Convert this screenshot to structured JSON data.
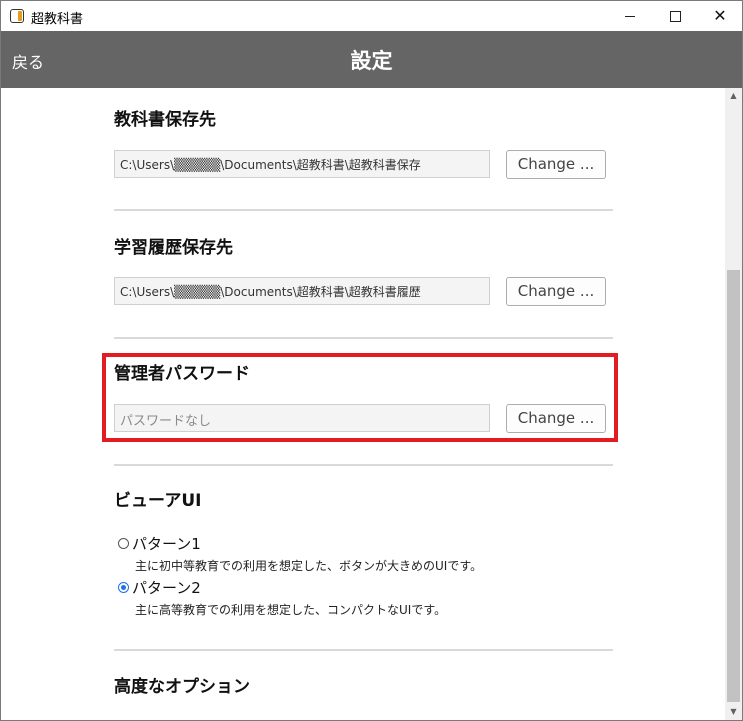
{
  "window": {
    "title": "超教科書",
    "icon": "app-logo-icon",
    "controls": [
      "minimize-icon",
      "maximize-icon",
      "close-icon"
    ]
  },
  "header": {
    "back_label": "戻る",
    "title": "設定"
  },
  "sections": {
    "textbook_location": {
      "title": "教科書保存先",
      "path": "C:\\Users\\▒▒▒▒▒\\Documents\\超教科書\\超教科書保存",
      "button": "Change ..."
    },
    "history_location": {
      "title": "学習履歴保存先",
      "path": "C:\\Users\\▒▒▒▒▒\\Documents\\超教科書\\超教科書履歴",
      "button": "Change ..."
    },
    "admin_password": {
      "title": "管理者パスワード",
      "placeholder": "パスワードなし",
      "button": "Change ..."
    },
    "viewer_ui": {
      "title": "ビューアUI",
      "options": [
        {
          "label": "パターン1",
          "description": "主に初中等教育での利用を想定した、ボタンが大きめのUIです。",
          "selected": false
        },
        {
          "label": "パターン2",
          "description": "主に高等教育での利用を想定した、コンパクトなUIです。",
          "selected": true
        }
      ]
    },
    "advanced": {
      "title": "高度なオプション"
    }
  },
  "colors": {
    "header_bg": "#656565",
    "highlight": "#e31c24",
    "radio_accent": "#1a73e8"
  }
}
